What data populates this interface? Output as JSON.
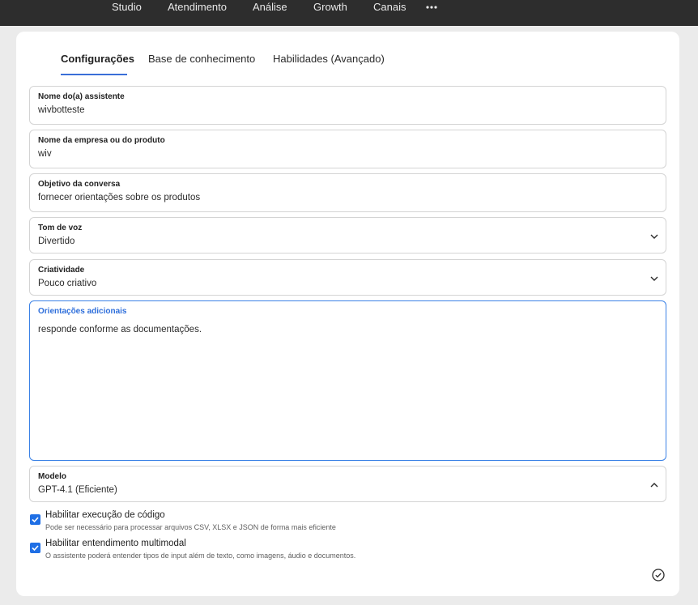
{
  "topnav": {
    "items": [
      "Studio",
      "Atendimento",
      "Análise",
      "Growth",
      "Canais"
    ],
    "more_icon": "more-horizontal-icon"
  },
  "tabs": {
    "items": [
      "Configurações",
      "Base de conhecimento",
      "Habilidades (Avançado)"
    ],
    "active": "Configurações"
  },
  "form": {
    "assistant_name": {
      "label": "Nome do(a) assistente",
      "value": "wivbotteste"
    },
    "company_name": {
      "label": "Nome da empresa ou do produto",
      "value": "wiv"
    },
    "objective": {
      "label": "Objetivo da conversa",
      "value": "fornecer orientações sobre os produtos"
    },
    "tone": {
      "label": "Tom de voz",
      "value": "Divertido"
    },
    "creativity": {
      "label": "Criatividade",
      "value": "Pouco criativo"
    },
    "guidelines": {
      "label": "Orientações adicionais",
      "value": "responde conforme as  documentações."
    },
    "model": {
      "label": "Modelo",
      "value": "GPT-4.1 (Eficiente)"
    }
  },
  "options": {
    "code_execution": {
      "title": "Habilitar execução de código",
      "description": "Pode ser necessário para processar arquivos CSV, XLSX e JSON de forma mais eficiente",
      "checked": true
    },
    "multimodal": {
      "title": "Habilitar entendimento multimodal",
      "description": "O assistente poderá entender tipos de input além de texto, como imagens, áudio e documentos.",
      "checked": true
    }
  },
  "colors": {
    "topbar": "#2d2d2d",
    "accent": "#1f6fe5",
    "focus_border": "#3b82e6",
    "background": "#ebebeb"
  },
  "icons": {
    "dropdown": "chevron-down-icon",
    "dropdown_open": "chevron-up-icon",
    "checkbox": "check-icon",
    "save": "check-circle-icon"
  }
}
